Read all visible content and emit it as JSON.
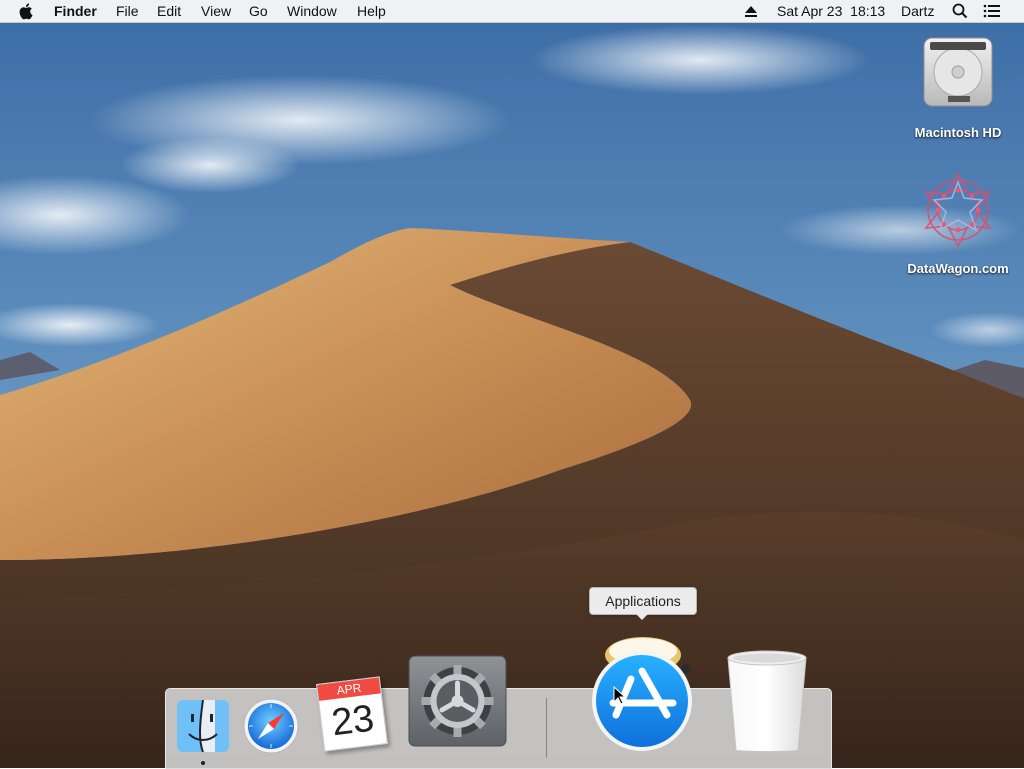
{
  "menubar": {
    "app_name": "Finder",
    "menus": [
      "File",
      "Edit",
      "View",
      "Go",
      "Window",
      "Help"
    ],
    "status": {
      "eject_icon": "eject-icon",
      "datetime": "Sat Apr 23  18:13",
      "user": "Dartz",
      "search_icon": "spotlight-search-icon",
      "notification_icon": "notification-center-icon"
    }
  },
  "desktop": {
    "icons": [
      {
        "label": "Macintosh HD",
        "icon": "hard-drive-icon"
      },
      {
        "label": "DataWagon.com",
        "icon": "network-volume-icon"
      }
    ]
  },
  "dock": {
    "apps": [
      {
        "name": "Finder",
        "icon": "finder-icon",
        "running": true
      },
      {
        "name": "Safari",
        "icon": "safari-icon",
        "running": false
      },
      {
        "name": "Calendar",
        "icon": "calendar-icon",
        "running": false,
        "month": "APR",
        "day": "23"
      },
      {
        "name": "System Preferences",
        "icon": "system-preferences-icon",
        "running": false
      }
    ],
    "stack_items": [
      {
        "name": "Applications",
        "icon": "app-store-folder-icon"
      },
      {
        "name": "Trash",
        "icon": "trash-icon"
      }
    ],
    "tooltip": "Applications"
  },
  "colors": {
    "sky_top": "#3f6fa6",
    "sky_bottom": "#8fb2d2",
    "sand_light": "#d7a86a",
    "sand_shadow": "#5a3f2a",
    "dock_bg": "#d7d7d7",
    "app_store_blue": "#1e8cf0"
  }
}
